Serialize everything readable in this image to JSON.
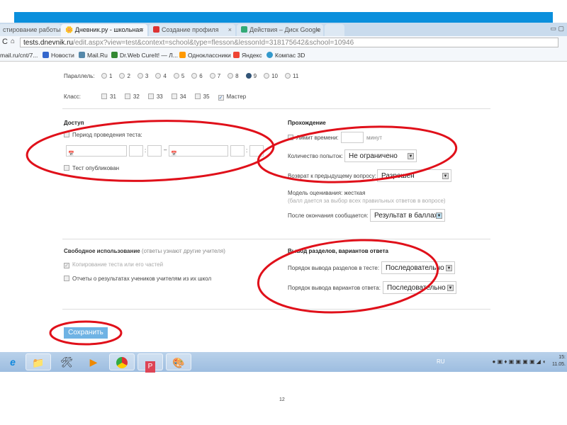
{
  "browser": {
    "tabs": [
      {
        "label": "стирование работы"
      },
      {
        "label": "Дневник.ру - школьная"
      },
      {
        "label": "Создание профиля"
      },
      {
        "label": "Действия – Диск Google"
      }
    ],
    "url_host": "tests.dnevnik.ru",
    "url_path": "/edit.aspx?view=test&context=school&type=flesson&lessonId=318175642&school=10946",
    "bookmarks": [
      "mail.ru/cnt/7...",
      "Новости",
      "Mail.Ru",
      "Dr.Web CureIt! — Л...",
      "Одноклассники",
      "Яндекс",
      "Компас 3D"
    ]
  },
  "form": {
    "parallel_label": "Параллель:",
    "parallels": [
      "1",
      "2",
      "3",
      "4",
      "5",
      "6",
      "7",
      "8",
      "9",
      "10",
      "11"
    ],
    "parallel_selected": "9",
    "class_label": "Класс:",
    "classes": [
      {
        "label": "31",
        "checked": false
      },
      {
        "label": "32",
        "checked": false
      },
      {
        "label": "33",
        "checked": false
      },
      {
        "label": "34",
        "checked": false
      },
      {
        "label": "35",
        "checked": false
      },
      {
        "label": "Мастер",
        "checked": true
      }
    ],
    "access": {
      "title": "Доступ",
      "period_label": "Период проведения теста:",
      "published_label": "Тест опубликован",
      "sep_colon": ":",
      "sep_dash": "–"
    },
    "passing": {
      "title": "Прохождение",
      "time_limit_label": "Лимит времени:",
      "minutes": "минут",
      "attempts_label": "Количество попыток:",
      "attempts_value": "Не ограничено",
      "return_label": "Возврат к предыдущему вопросу:",
      "return_value": "Разрешен",
      "model_label": "Модель оценивания: жесткая",
      "model_note": "(балл дается за выбор всех правильных ответов в вопросе)",
      "after_label": "После окончания сообщается:",
      "after_value": "Результат в баллах"
    },
    "free_use": {
      "title": "Свободное использование",
      "note": "(ответы узнают другие учителя)",
      "copy_label": "Копирование теста или его частей",
      "reports_label": "Отчеты о результатах учеников учителям из их школ"
    },
    "output": {
      "title": "Вывод разделов, вариантов ответа",
      "sections_label": "Порядок вывода разделов в тесте:",
      "sections_value": "Последовательно",
      "answers_label": "Порядок вывода вариантов ответа:",
      "answers_value": "Последовательно"
    },
    "save_label": "Сохранить"
  },
  "taskbar": {
    "lang": "RU",
    "time": "15:",
    "date": "11.05."
  },
  "slide_number": "12",
  "colors": {
    "accent": "#0a8fdc",
    "annotation": "#e0101a",
    "button": "#6fb3e4"
  }
}
